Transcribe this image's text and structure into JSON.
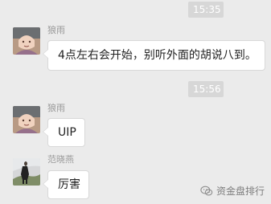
{
  "chat": {
    "timestamps": [
      {
        "label": "15:35"
      },
      {
        "label": "15:56"
      }
    ],
    "messages": [
      {
        "sender": "狼雨",
        "text": "4点左右会开始，别听外面的胡说八到。"
      },
      {
        "sender": "狼雨",
        "text": "UIP"
      },
      {
        "sender": "范晓燕",
        "text": "厉害"
      }
    ]
  },
  "watermark": {
    "text": "资金盘排行",
    "icon": "wechat-icon"
  },
  "colors": {
    "background": "#ebebeb",
    "bubble": "#ffffff",
    "bubble_border": "#d8d8d8",
    "timestamp_bg": "#d7d7d7",
    "sender_text": "#9a9a9a",
    "watermark_text": "#7e7e7e"
  }
}
